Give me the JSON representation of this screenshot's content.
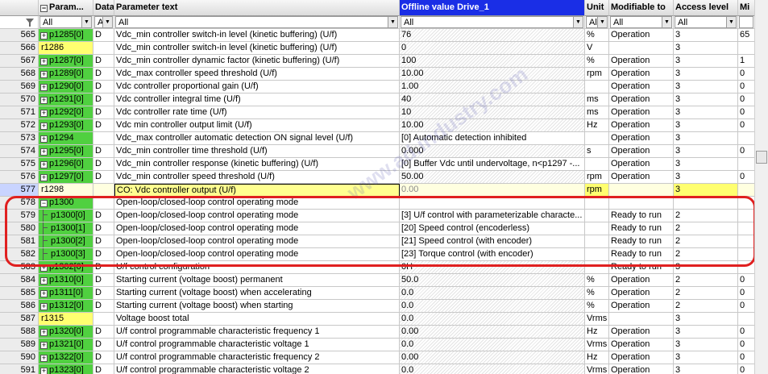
{
  "header": {
    "param": "Param...",
    "data": "Data",
    "text": "Parameter text",
    "offline": "Offline value Drive_1",
    "unit": "Unit",
    "modifiable": "Modifiable to",
    "access": "Access level",
    "mi": "Mi"
  },
  "filter": {
    "param": "All",
    "data": "A",
    "text": "All",
    "offline": "All",
    "unit": "Al",
    "modifiable": "All",
    "access": "All",
    "mi": ""
  },
  "watermark": "www.ad.industry.com",
  "rows": [
    {
      "n": "565",
      "p": "p1285[0]",
      "d": "D",
      "t": "Vdc_min controller switch-in level (kinetic buffering) (U/f)",
      "o": "76",
      "u": "%",
      "m": "Operation",
      "a": "3",
      "mi": "65"
    },
    {
      "n": "566",
      "p": "r1286",
      "d": "",
      "t": "Vdc_min controller switch-in level (kinetic buffering) (U/f)",
      "o": "0",
      "u": "V",
      "m": "",
      "a": "3",
      "mi": ""
    },
    {
      "n": "567",
      "p": "p1287[0]",
      "d": "D",
      "t": "Vdc_min controller dynamic factor (kinetic buffering) (U/f)",
      "o": "100",
      "u": "%",
      "m": "Operation",
      "a": "3",
      "mi": "1"
    },
    {
      "n": "568",
      "p": "p1289[0]",
      "d": "D",
      "t": "Vdc_max controller speed threshold (U/f)",
      "o": "10.00",
      "u": "rpm",
      "m": "Operation",
      "a": "3",
      "mi": "0"
    },
    {
      "n": "569",
      "p": "p1290[0]",
      "d": "D",
      "t": "Vdc controller proportional gain (U/f)",
      "o": "1.00",
      "u": "",
      "m": "Operation",
      "a": "3",
      "mi": "0"
    },
    {
      "n": "570",
      "p": "p1291[0]",
      "d": "D",
      "t": "Vdc controller integral time (U/f)",
      "o": "40",
      "u": "ms",
      "m": "Operation",
      "a": "3",
      "mi": "0"
    },
    {
      "n": "571",
      "p": "p1292[0]",
      "d": "D",
      "t": "Vdc controller rate time (U/f)",
      "o": "10",
      "u": "ms",
      "m": "Operation",
      "a": "3",
      "mi": "0"
    },
    {
      "n": "572",
      "p": "p1293[0]",
      "d": "D",
      "t": "Vdc min controller output limit (U/f)",
      "o": "10.00",
      "u": "Hz",
      "m": "Operation",
      "a": "3",
      "mi": "0"
    },
    {
      "n": "573",
      "p": "p1294",
      "d": "",
      "t": "Vdc_max controller automatic detection ON signal level (U/f)",
      "o": "[0] Automatic detection inhibited",
      "u": "",
      "m": "Operation",
      "a": "3",
      "mi": ""
    },
    {
      "n": "574",
      "p": "p1295[0]",
      "d": "D",
      "t": "Vdc_min controller time threshold (U/f)",
      "o": "0.000",
      "u": "s",
      "m": "Operation",
      "a": "3",
      "mi": "0"
    },
    {
      "n": "575",
      "p": "p1296[0]",
      "d": "D",
      "t": "Vdc_min controller response (kinetic buffering) (U/f)",
      "o": "[0] Buffer Vdc until undervoltage, n<p1297 -...",
      "u": "",
      "m": "Operation",
      "a": "3",
      "mi": ""
    },
    {
      "n": "576",
      "p": "p1297[0]",
      "d": "D",
      "t": "Vdc_min controller speed threshold (U/f)",
      "o": "50.00",
      "u": "rpm",
      "m": "Operation",
      "a": "3",
      "mi": "0"
    },
    {
      "n": "577",
      "p": "r1298",
      "d": "",
      "t": "CO: Vdc controller output (U/f)",
      "o": "0.00",
      "u": "rpm",
      "m": "",
      "a": "3",
      "mi": ""
    },
    {
      "n": "578",
      "p": "p1300",
      "d": "",
      "t": "Open-loop/closed-loop control operating mode",
      "o": "",
      "u": "",
      "m": "",
      "a": "",
      "mi": ""
    },
    {
      "n": "579",
      "p": "p1300[0]",
      "d": "D",
      "t": "Open-loop/closed-loop control operating mode",
      "o": "[3] U/f control with parameterizable characte...",
      "u": "",
      "m": "Ready to run",
      "a": "2",
      "mi": ""
    },
    {
      "n": "580",
      "p": "p1300[1]",
      "d": "D",
      "t": "Open-loop/closed-loop control operating mode",
      "o": "[20] Speed control (encoderless)",
      "u": "",
      "m": "Ready to run",
      "a": "2",
      "mi": ""
    },
    {
      "n": "581",
      "p": "p1300[2]",
      "d": "D",
      "t": "Open-loop/closed-loop control operating mode",
      "o": "[21] Speed control (with encoder)",
      "u": "",
      "m": "Ready to run",
      "a": "2",
      "mi": ""
    },
    {
      "n": "582",
      "p": "p1300[3]",
      "d": "D",
      "t": "Open-loop/closed-loop control operating mode",
      "o": "[23] Torque control (with encoder)",
      "u": "",
      "m": "Ready to run",
      "a": "2",
      "mi": ""
    },
    {
      "n": "583",
      "p": "p1302[0]",
      "d": "D",
      "t": "U/f control configuration",
      "o": "0H",
      "u": "",
      "m": "Ready to run",
      "a": "3",
      "mi": ""
    },
    {
      "n": "584",
      "p": "p1310[0]",
      "d": "D",
      "t": "Starting current (voltage boost) permanent",
      "o": "50.0",
      "u": "%",
      "m": "Operation",
      "a": "2",
      "mi": "0"
    },
    {
      "n": "585",
      "p": "p1311[0]",
      "d": "D",
      "t": "Starting current (voltage boost) when accelerating",
      "o": "0.0",
      "u": "%",
      "m": "Operation",
      "a": "2",
      "mi": "0"
    },
    {
      "n": "586",
      "p": "p1312[0]",
      "d": "D",
      "t": "Starting current (voltage boost) when starting",
      "o": "0.0",
      "u": "%",
      "m": "Operation",
      "a": "2",
      "mi": "0"
    },
    {
      "n": "587",
      "p": "r1315",
      "d": "",
      "t": "Voltage boost total",
      "o": "0.0",
      "u": "Vrms",
      "m": "",
      "a": "3",
      "mi": ""
    },
    {
      "n": "588",
      "p": "p1320[0]",
      "d": "D",
      "t": "U/f control programmable characteristic frequency 1",
      "o": "0.00",
      "u": "Hz",
      "m": "Operation",
      "a": "3",
      "mi": "0"
    },
    {
      "n": "589",
      "p": "p1321[0]",
      "d": "D",
      "t": "U/f control programmable characteristic voltage 1",
      "o": "0.0",
      "u": "Vrms",
      "m": "Operation",
      "a": "3",
      "mi": "0"
    },
    {
      "n": "590",
      "p": "p1322[0]",
      "d": "D",
      "t": "U/f control programmable characteristic frequency 2",
      "o": "0.00",
      "u": "Hz",
      "m": "Operation",
      "a": "3",
      "mi": "0"
    },
    {
      "n": "591",
      "p": "p1323[0]",
      "d": "D",
      "t": "U/f control programmable characteristic voltage 2",
      "o": "0.0",
      "u": "Vrms",
      "m": "Operation",
      "a": "3",
      "mi": "0"
    }
  ]
}
